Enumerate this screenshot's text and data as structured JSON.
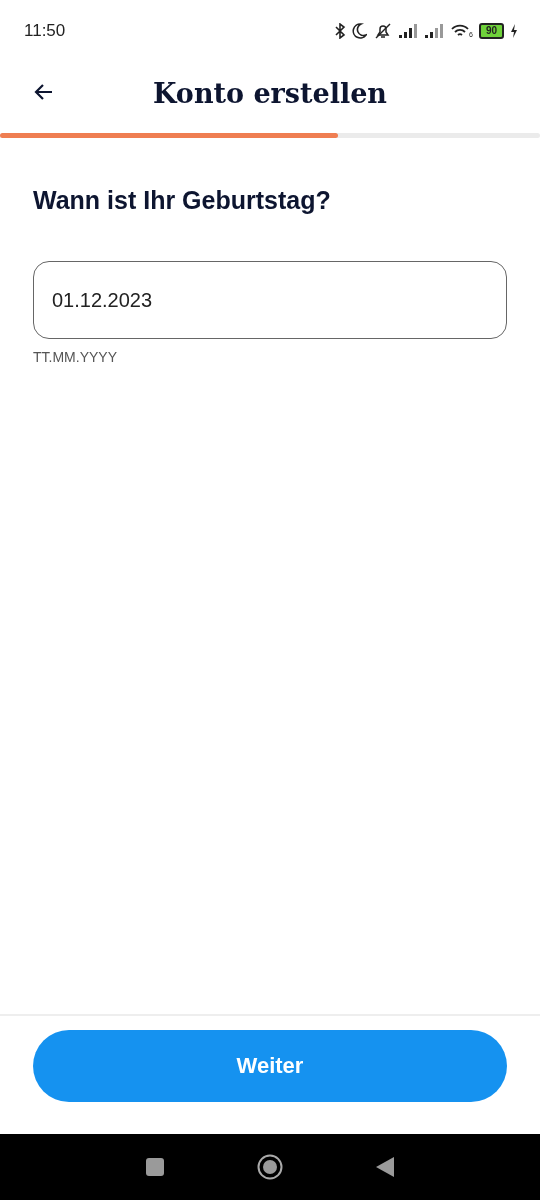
{
  "status_bar": {
    "time": "11:50",
    "wifi_label": "6",
    "battery": "90"
  },
  "header": {
    "title": "Konto erstellen"
  },
  "progress": {
    "level": 0.625
  },
  "question": "Wann ist Ihr Geburtstag?",
  "date_field": {
    "value": "01.12.2023",
    "hint": "TT.MM.YYYY"
  },
  "primary_button": "Weiter"
}
